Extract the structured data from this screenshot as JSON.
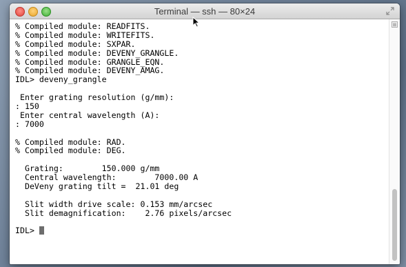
{
  "window": {
    "title": "Terminal — ssh — 80×24"
  },
  "terminal": {
    "lines": [
      "% Compiled module: READFITS.",
      "% Compiled module: WRITEFITS.",
      "% Compiled module: SXPAR.",
      "% Compiled module: DEVENY_GRANGLE.",
      "% Compiled module: GRANGLE_EQN.",
      "% Compiled module: DEVENY_AMAG.",
      "IDL> deveny_grangle",
      "",
      " Enter grating resolution (g/mm):",
      ": 150",
      " Enter central wavelength (A):",
      ": 7000",
      "",
      "% Compiled module: RAD.",
      "% Compiled module: DEG.",
      "",
      "  Grating:        150.000 g/mm",
      "  Central wavelength:        7000.00 A",
      "  DeVeny grating tilt =  21.01 deg",
      "",
      "  Slit width drive scale: 0.153 mm/arcsec",
      "  Slit demagnification:    2.76 pixels/arcsec",
      ""
    ],
    "prompt": "IDL> "
  },
  "icons": {
    "close": "close-button",
    "minimize": "minimize-button",
    "zoom": "zoom-button",
    "fullscreen": "fullscreen-arrows-icon",
    "cursor": "mouse-pointer-icon"
  },
  "colors": {
    "close": "#e0443a",
    "minimize": "#e8a52a",
    "zoom": "#3fae35",
    "terminal_bg": "#ffffff",
    "terminal_fg": "#000000"
  }
}
